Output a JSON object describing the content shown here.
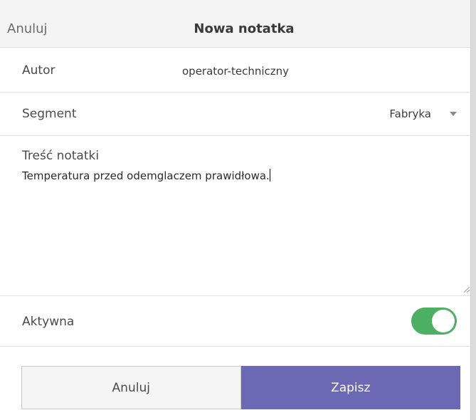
{
  "header": {
    "cancel_label": "Anuluj",
    "title": "Nowa notatka"
  },
  "author": {
    "label": "Autor",
    "value": "operator-techniczny"
  },
  "segment": {
    "label": "Segment",
    "selected": "Fabryka"
  },
  "note": {
    "label": "Treść notatki",
    "value": "Temperatura przed odemglaczem prawidłowa."
  },
  "active": {
    "label": "Aktywna",
    "checked": true
  },
  "footer": {
    "cancel_label": "Anuluj",
    "save_label": "Zapisz"
  },
  "colors": {
    "accent": "#6b69b4",
    "toggle_on": "#4caf63"
  }
}
